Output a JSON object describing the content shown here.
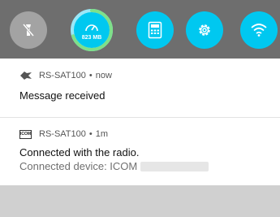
{
  "quick_settings": {
    "tiles": [
      {
        "name": "flashlight",
        "icon": "flashlight-off-icon",
        "active": false
      },
      {
        "name": "memory",
        "icon": "speedometer-icon",
        "active": true,
        "label": "823 MB",
        "usage_fraction": 0.7
      },
      {
        "name": "calculator",
        "icon": "calculator-icon",
        "active": true
      },
      {
        "name": "settings",
        "icon": "gear-icon",
        "active": true
      },
      {
        "name": "wifi",
        "icon": "wifi-icon",
        "active": true
      }
    ],
    "colors": {
      "bar": "#6e6e6e",
      "active_tile": "#00c8f0",
      "inactive_tile": "#a3a3a3",
      "ring": "#7ee08a"
    }
  },
  "notifications": [
    {
      "app_icon": "rs-sat-app-icon",
      "app_name": "RS-SAT100",
      "separator": "•",
      "time": "now",
      "title": "Message received"
    },
    {
      "app_icon": "icom-logo-icon",
      "app_icon_text": "ICOM",
      "app_name": "RS-SAT100",
      "separator": "•",
      "time": "1m",
      "title": "Connected with the radio.",
      "text": "Connected device: ICOM"
    }
  ]
}
